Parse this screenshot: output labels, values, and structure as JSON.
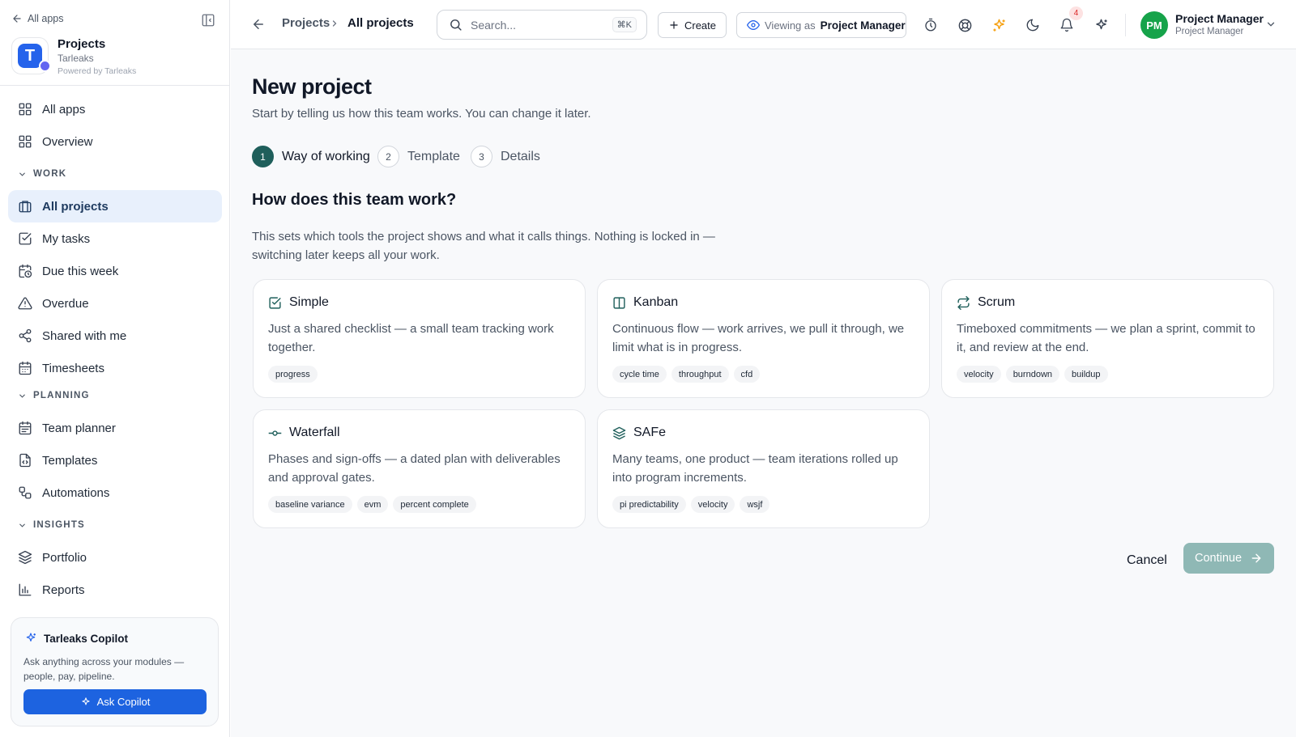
{
  "sidebar": {
    "back_label": "All apps",
    "app": {
      "name": "Projects",
      "org": "Tarleaks",
      "powered_by": "Powered by Tarleaks",
      "logo_letter": "T"
    },
    "top_items": [
      {
        "label": "All apps",
        "icon": "grid-icon"
      },
      {
        "label": "Overview",
        "icon": "grid-icon"
      }
    ],
    "sections": {
      "work": "WORK",
      "planning": "PLANNING",
      "insights": "INSIGHTS"
    },
    "work_items": [
      {
        "label": "All projects",
        "icon": "briefcase-icon",
        "active": true
      },
      {
        "label": "My tasks",
        "icon": "checkbox-icon"
      },
      {
        "label": "Due this week",
        "icon": "calendar-clock-icon"
      },
      {
        "label": "Overdue",
        "icon": "warning-icon"
      },
      {
        "label": "Shared with me",
        "icon": "share-icon"
      },
      {
        "label": "Timesheets",
        "icon": "calendar-icon"
      }
    ],
    "planning_items": [
      {
        "label": "Team planner",
        "icon": "calendar-grid-icon"
      },
      {
        "label": "Templates",
        "icon": "file-code-icon"
      },
      {
        "label": "Automations",
        "icon": "workflow-icon"
      }
    ],
    "insights_items": [
      {
        "label": "Portfolio",
        "icon": "layers-icon"
      },
      {
        "label": "Reports",
        "icon": "bar-chart-icon"
      }
    ],
    "copilot": {
      "title": "Tarleaks Copilot",
      "description": "Ask anything across your modules — people, pay, pipeline.",
      "button": "Ask Copilot"
    }
  },
  "topbar": {
    "breadcrumb": [
      "Projects",
      "All projects"
    ],
    "search_placeholder": "Search...",
    "search_shortcut": "⌘K",
    "create_label": "Create",
    "viewing_prefix": "Viewing as",
    "viewing_role": "Project Manager",
    "notification_count": "4",
    "user": {
      "initials": "PM",
      "name": "Project Manager",
      "role": "Project Manager"
    }
  },
  "page": {
    "title": "New project",
    "subtitle": "Start by telling us how this team works. You can change it later.",
    "steps": [
      {
        "num": "1",
        "label": "Way of working",
        "active": true
      },
      {
        "num": "2",
        "label": "Template"
      },
      {
        "num": "3",
        "label": "Details"
      }
    ],
    "question": "How does this team work?",
    "question_desc": "This sets which tools the project shows and what it calls things. Nothing is locked in — switching later keeps all your work.",
    "options": [
      {
        "title": "Simple",
        "icon": "checkbox-icon",
        "desc": "Just a shared checklist — a small team tracking work together.",
        "tags": [
          "progress"
        ]
      },
      {
        "title": "Kanban",
        "icon": "columns-icon",
        "desc": "Continuous flow — work arrives, we pull it through, we limit what is in progress.",
        "tags": [
          "cycle time",
          "throughput",
          "cfd"
        ]
      },
      {
        "title": "Scrum",
        "icon": "repeat-icon",
        "desc": "Timeboxed commitments — we plan a sprint, commit to it, and review at the end.",
        "tags": [
          "velocity",
          "burndown",
          "buildup"
        ]
      },
      {
        "title": "Waterfall",
        "icon": "commit-icon",
        "desc": "Phases and sign-offs — a dated plan with deliverables and approval gates.",
        "tags": [
          "baseline variance",
          "evm",
          "percent complete"
        ]
      },
      {
        "title": "SAFe",
        "icon": "layers-icon",
        "desc": "Many teams, one product — team iterations rolled up into program increments.",
        "tags": [
          "pi predictability",
          "velocity",
          "wsjf"
        ]
      }
    ],
    "cancel_label": "Cancel",
    "continue_label": "Continue"
  },
  "colors": {
    "accent": "#1f5f5b",
    "primary_button": "#1d63e0",
    "continue_disabled": "#8fb8b5",
    "active_nav_bg": "#e8f0fc",
    "avatar": "#16a34a"
  }
}
